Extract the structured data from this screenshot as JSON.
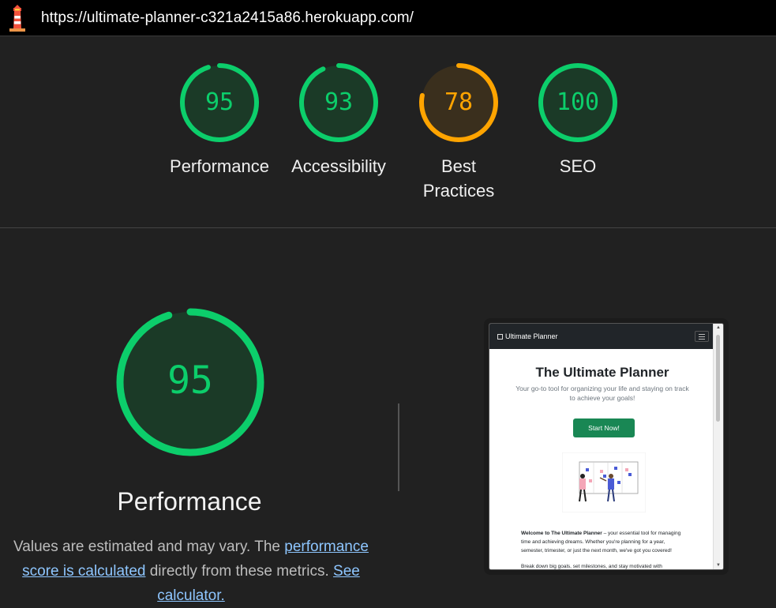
{
  "url": "https://ultimate-planner-c321a2415a86.herokuapp.com/",
  "colors": {
    "pass": "#0cce6b",
    "average": "#ffa400",
    "background": "#212121"
  },
  "categories": [
    {
      "score": "95",
      "label": "Performance",
      "status": "pass"
    },
    {
      "score": "93",
      "label": "Accessibility",
      "status": "pass"
    },
    {
      "score": "78",
      "label": "Best Practices",
      "status": "average"
    },
    {
      "score": "100",
      "label": "SEO",
      "status": "pass"
    }
  ],
  "performance": {
    "score": "95",
    "title": "Performance",
    "desc_prefix": "Values are estimated and may vary. The ",
    "link_score": "performance score is calculated",
    "desc_middle": " directly from these metrics. ",
    "link_calculator": "See calculator."
  },
  "preview": {
    "brand": "Ultimate Planner",
    "title": "The Ultimate Planner",
    "subtitle": "Your go-to tool for organizing your life and staying on track to achieve your goals!",
    "button": "Start Now!",
    "welcome_bold": "Welcome to The Ultimate Planner",
    "welcome_rest": " – your essential tool for managing time and achieving dreams. Whether you're planning for a year, semester, trimester, or just the next month, we've got you covered!",
    "para2": "Break down big goals, set milestones, and stay motivated with"
  }
}
